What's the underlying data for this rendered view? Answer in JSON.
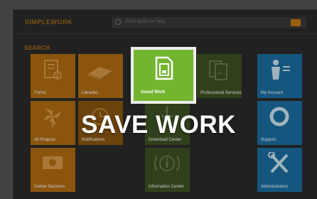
{
  "header": {
    "brand": "SIMPLEWORK",
    "search_placeholder": "Find tasks or help"
  },
  "section_label": "SEARCH",
  "tiles": [
    {
      "label": "Forms",
      "icon": "certificate-icon"
    },
    {
      "label": "Libraries",
      "icon": "book-icon"
    },
    {
      "label": "Save Work",
      "icon": "save-document-icon"
    },
    {
      "label": "Professional Services",
      "icon": "documents-icon"
    },
    {
      "label": "My Account",
      "icon": "person-icon"
    },
    {
      "label": "All Projects",
      "icon": "pinwheel-icon"
    },
    {
      "label": "Notifications",
      "icon": "clock-icon"
    },
    {
      "label": "Download Center",
      "icon": "download-icon"
    },
    {
      "label": "Support",
      "icon": "lifebuoy-icon"
    },
    {
      "label": "Online Sessions",
      "icon": "webcam-icon"
    },
    {
      "label": "Information Center",
      "icon": "info-icon"
    },
    {
      "label": "Administration",
      "icon": "tools-icon"
    }
  ],
  "overlay": {
    "caption": "SAVE WORK",
    "highlighted_label": "Saved Work"
  },
  "colors": {
    "orange": "#b36e13",
    "green": "#74b530",
    "blue": "#1a6fa0",
    "background": "#2b2b2b"
  }
}
